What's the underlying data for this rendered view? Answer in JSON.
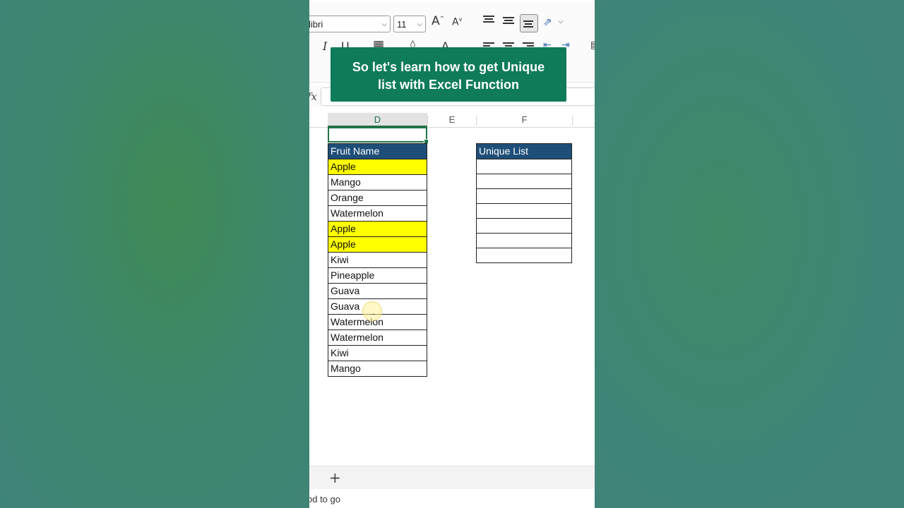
{
  "ribbon": {
    "font_name": "libri",
    "font_size": "11",
    "grow_font": "A",
    "shrink_font": "A",
    "italic": "I",
    "underline": "U",
    "font_color": "A"
  },
  "banner": {
    "line1": "So let's learn how to get Unique",
    "line2": "list with Excel Function"
  },
  "formula_bar": {
    "fx_label": "fx"
  },
  "columns": [
    "D",
    "E",
    "F"
  ],
  "fruit_table": {
    "header": "Fruit Name",
    "rows": [
      {
        "name": "Apple",
        "highlight": true
      },
      {
        "name": "Mango",
        "highlight": false
      },
      {
        "name": "Orange",
        "highlight": false
      },
      {
        "name": "Watermelon",
        "highlight": false
      },
      {
        "name": "Apple",
        "highlight": true
      },
      {
        "name": "Apple",
        "highlight": true
      },
      {
        "name": "Kiwi",
        "highlight": false
      },
      {
        "name": "Pineapple",
        "highlight": false
      },
      {
        "name": "Guava",
        "highlight": false
      },
      {
        "name": "Guava",
        "highlight": false
      },
      {
        "name": "Watermelon",
        "highlight": false
      },
      {
        "name": "Watermelon",
        "highlight": false
      },
      {
        "name": "Kiwi",
        "highlight": false
      },
      {
        "name": "Mango",
        "highlight": false
      }
    ]
  },
  "unique_table": {
    "header": "Unique List",
    "empty_rows": 7
  },
  "sheet_bar": {
    "add_sheet": "+"
  },
  "status_bar": {
    "text": "od to go"
  },
  "colors": {
    "excel_green": "#217346",
    "banner_green": "#0f7b5a",
    "header_blue": "#1f4e78",
    "highlight_yellow": "#ffff00"
  }
}
